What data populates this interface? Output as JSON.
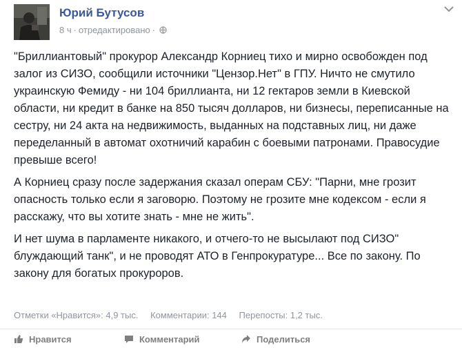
{
  "post": {
    "author": "Юрий Бутусов",
    "time": "8 ч",
    "edited": "отредактировано",
    "paragraphs": [
      "\"Бриллиантовый\" прокурор Александр Корниец тихо и мирно освобожден под залог из СИЗО, сообщили источники \"Цензор.Нет\" в ГПУ. Ничто не смутило украинскую Фемиду - ни 104 бриллианта, ни 12 гектаров земли в Киевской области, ни кредит в банке на 850 тысяч долларов, ни бизнесы, переписанные на сестру, ни 24 акта на недвижимость, выданных на подставных лиц, ни даже переделанный в автомат охотничий карабин с боевыми патронами. Правосудие превыше всего!",
      "А Корниец сразу после задержания сказал операм СБУ: \"Парни, мне грозит опасность только если я заговорю. Поэтому не грозите мне кодексом - если я расскажу, что вы хотите знать - мне не жить\".",
      "И нет шума в парламенте никакого, и отчего-то не высылают под СИЗО\" блуждающий танк\", и не проводят АТО в Генпрокуратуре... Все по закону. По закону для богатых прокуроров."
    ],
    "stats": {
      "likes": "Отметки «Нравится»: 4,9 тыс.",
      "comments": "Комментарии: 144",
      "shares": "Перепосты: 1,2 тыс."
    },
    "actions": {
      "like": "Нравится",
      "comment": "Комментарий",
      "share": "Поделиться"
    },
    "icons": {
      "avatar": "avatar-photo",
      "privacy": "globe-icon",
      "options": "chevron-down-icon",
      "like": "thumbs-up-icon",
      "comment": "speech-bubble-icon",
      "share": "share-arrow-icon"
    },
    "colors": {
      "author": "#3b5998",
      "meta": "#90949c",
      "text": "#1d2129"
    }
  }
}
